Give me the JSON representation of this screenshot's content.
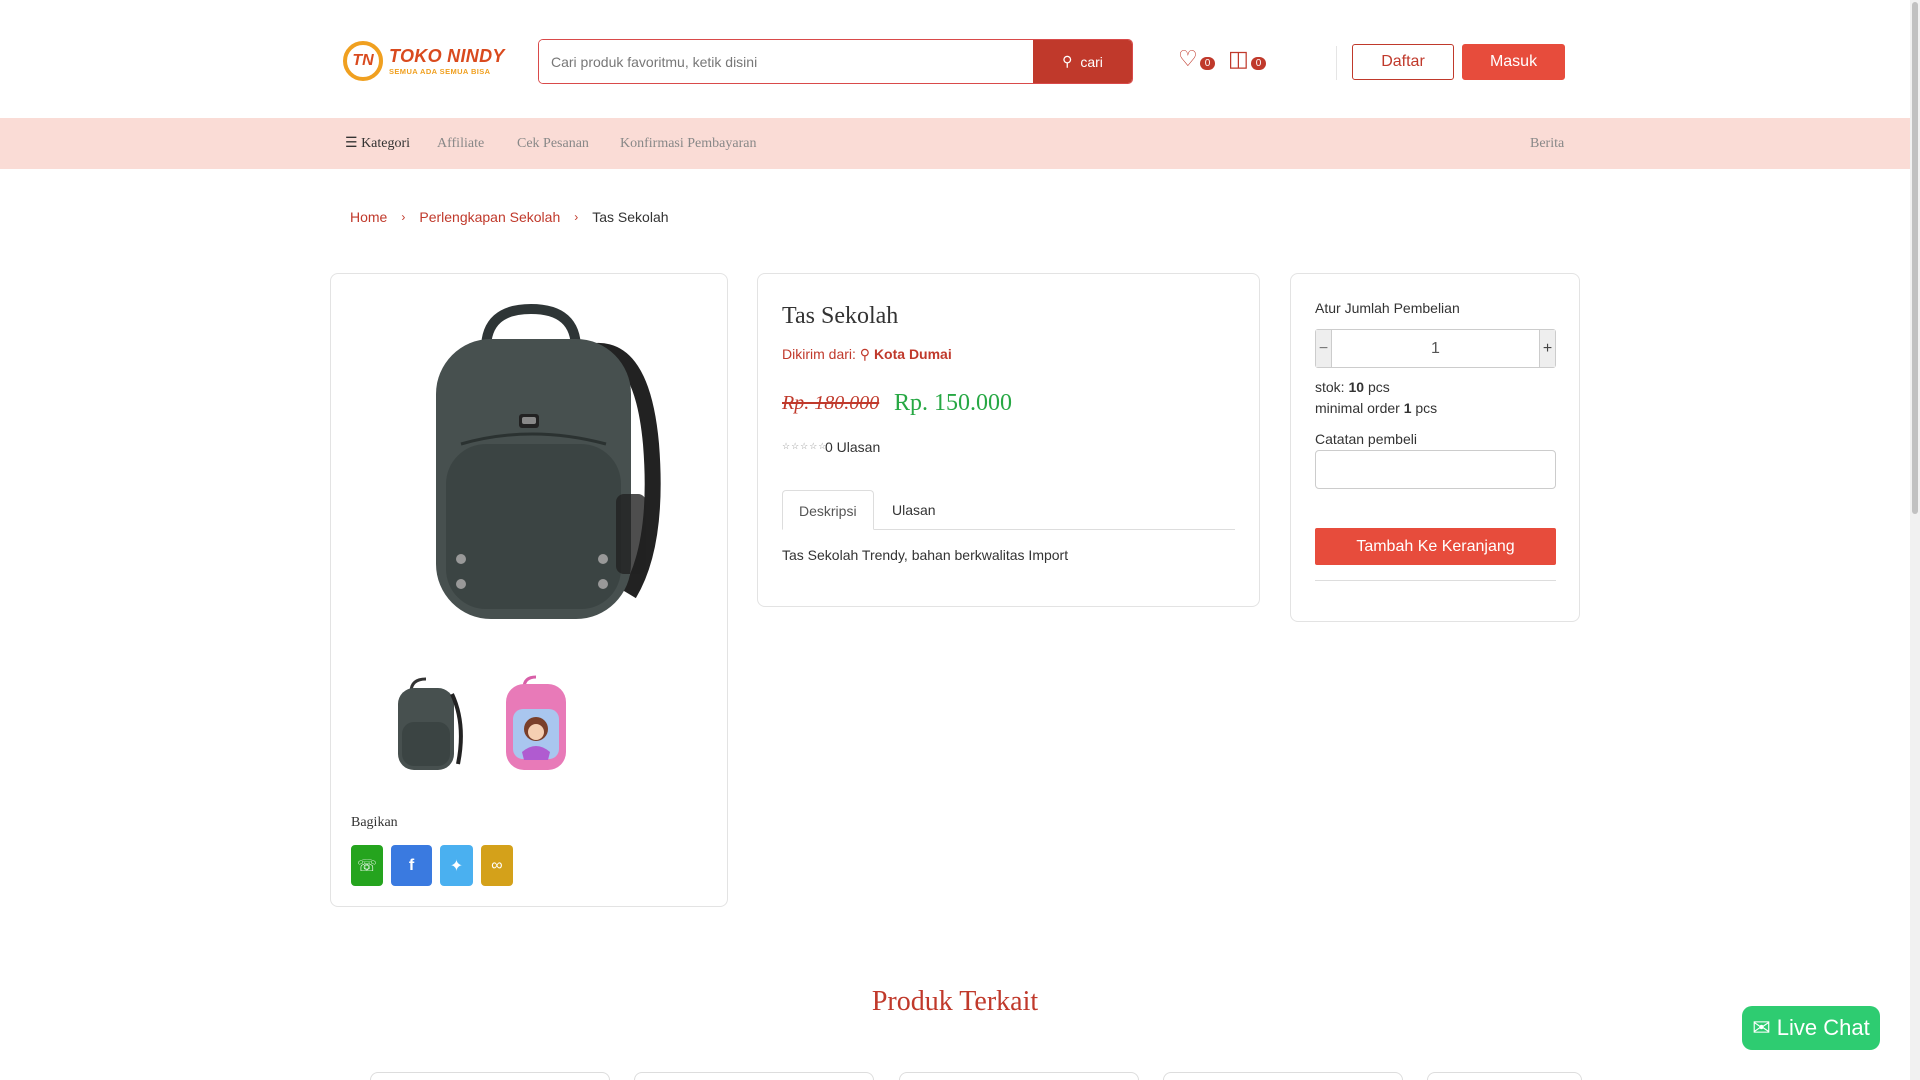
{
  "brand": {
    "logo_mark": "TN",
    "name": "TOKO NINDY",
    "tagline": "SEMUA ADA SEMUA BISA",
    "accent": "#c0392b",
    "light_bar": "#fadcd6",
    "green": "#27a844"
  },
  "header": {
    "search_placeholder": "Cari produk favoritmu, ketik disini",
    "search_button": "cari",
    "wishlist_count": "0",
    "cart_count": "0",
    "register_label": "Daftar",
    "login_label": "Masuk"
  },
  "nav": {
    "category": "Kategori",
    "affiliate": "Affiliate",
    "check_order": "Cek Pesanan",
    "payment_confirm": "Konfirmasi Pembayaran",
    "news": "Berita"
  },
  "breadcrumb": {
    "home": "Home",
    "category": "Perlengkapan Sekolah",
    "current": "Tas Sekolah"
  },
  "gallery": {
    "share_label": "Bagikan"
  },
  "product": {
    "title": "Tas Sekolah",
    "ship_from_label": "Dikirim dari:",
    "ship_from_city": "Kota Dumai",
    "price_old": "Rp. 180.000",
    "price_new": "Rp. 150.000",
    "review_count": "0 Ulasan",
    "tab_description": "Deskripsi",
    "tab_reviews": "Ulasan",
    "description": "Tas Sekolah Trendy, bahan berkwalitas Import"
  },
  "purchase": {
    "qty_label": "Atur Jumlah Pembelian",
    "qty_value": "1",
    "stock_prefix": "stok:",
    "stock_value": "10",
    "stock_unit": "pcs",
    "min_prefix": "minimal order",
    "min_value": "1",
    "min_unit": "pcs",
    "note_label": "Catatan pembeli",
    "add_to_cart": "Tambah Ke Keranjang"
  },
  "related": {
    "title": "Produk Terkait"
  },
  "live_chat": "Live Chat"
}
